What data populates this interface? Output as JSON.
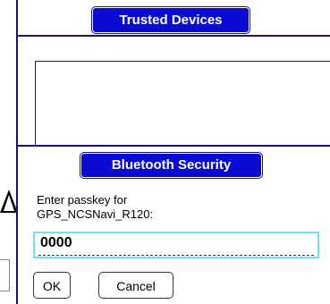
{
  "background_window": {
    "title": "Trusted Devices"
  },
  "dialog": {
    "title": "Bluetooth Security",
    "prompt_line1": "Enter passkey for",
    "prompt_line2": "GPS_NCSNavi_R120:",
    "passkey_value": "0000",
    "ok_label": "OK",
    "cancel_label": "Cancel"
  },
  "colors": {
    "title_bg": "#0a0ad2",
    "frame_line": "#141478",
    "field_border": "#6ee0f0"
  }
}
